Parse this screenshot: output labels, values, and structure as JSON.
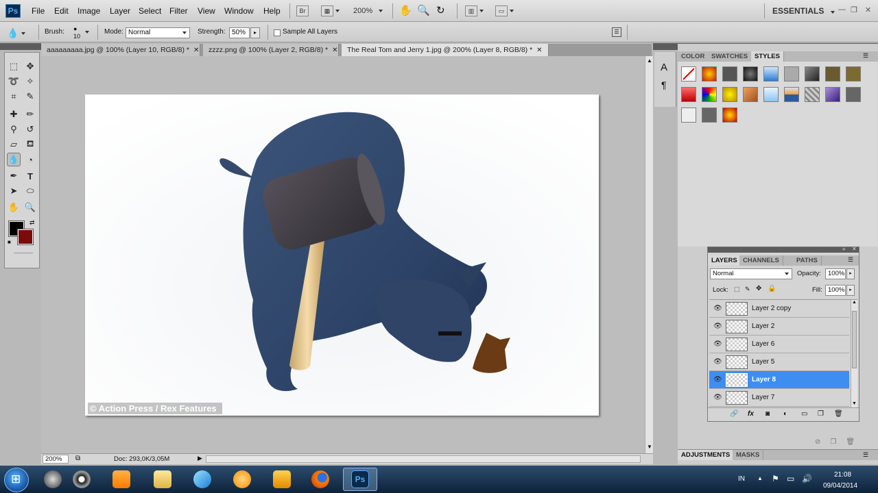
{
  "app": {
    "logo": "Ps",
    "workspace": "ESSENTIALS"
  },
  "menu": [
    "File",
    "Edit",
    "Image",
    "Layer",
    "Select",
    "Filter",
    "View",
    "Window",
    "Help"
  ],
  "app_bar": {
    "bridge": "Br",
    "zoom": "200%"
  },
  "options": {
    "brush_label": "Brush:",
    "brush_size": "10",
    "mode_label": "Mode:",
    "mode_value": "Normal",
    "strength_label": "Strength:",
    "strength_value": "50%",
    "sample_all_layers": "Sample All Layers"
  },
  "documents": [
    {
      "label": "aaaaaaaaa.jpg @ 100% (Layer 10, RGB/8) *",
      "active": false
    },
    {
      "label": "zzzz.png @ 100% (Layer 2, RGB/8) *",
      "active": false
    },
    {
      "label": "The Real Tom and Jerry 1.jpg @ 200% (Layer 8, RGB/8) *",
      "active": true
    }
  ],
  "canvas": {
    "watermark": "© Action Press / Rex Features"
  },
  "status": {
    "zoom": "200%",
    "doc": "Doc: 293,0K/3,05M"
  },
  "styles_panel": {
    "tabs": [
      "COLOR",
      "SWATCHES",
      "STYLES"
    ],
    "active_tab": "STYLES"
  },
  "layers_panel": {
    "tabs": [
      "LAYERS",
      "CHANNELS",
      "PATHS"
    ],
    "blend_mode": "Normal",
    "opacity_label": "Opacity:",
    "opacity": "100%",
    "lock_label": "Lock:",
    "fill_label": "Fill:",
    "fill": "100%",
    "layers": [
      {
        "name": "Layer 2 copy",
        "selected": false
      },
      {
        "name": "Layer 2",
        "selected": false
      },
      {
        "name": "Layer 6",
        "selected": false
      },
      {
        "name": "Layer 5",
        "selected": false
      },
      {
        "name": "Layer 8",
        "selected": true
      },
      {
        "name": "Layer 7",
        "selected": false
      }
    ]
  },
  "bottom_panel": {
    "tabs": [
      "ADJUSTMENTS",
      "MASKS"
    ]
  },
  "taskbar": {
    "language": "IN",
    "time": "21:08",
    "date": "09/04/2014"
  },
  "colors": {
    "foreground": "#000000",
    "background": "#7a0b0b",
    "selection": "#3d8ef0"
  }
}
